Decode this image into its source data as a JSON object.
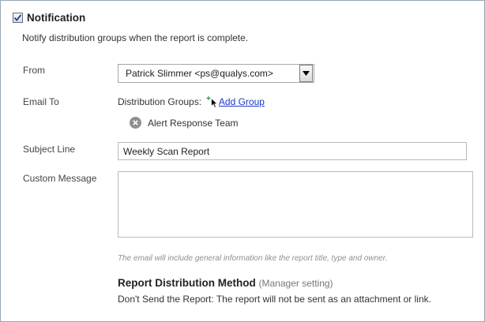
{
  "notification": {
    "checked": true,
    "title": "Notification",
    "description": "Notify distribution groups when the report is complete."
  },
  "from": {
    "label": "From",
    "selected": "Patrick Slimmer <ps@qualys.com>"
  },
  "email_to": {
    "label": "Email To",
    "distribution_label": "Distribution Groups:",
    "add_group_label": "Add Group",
    "groups": [
      "Alert Response Team"
    ]
  },
  "subject": {
    "label": "Subject Line",
    "value": "Weekly Scan Report"
  },
  "custom_message": {
    "label": "Custom Message",
    "value": "",
    "hint": "The email will include general information like the report title, type and owner."
  },
  "distribution_method": {
    "title": "Report Distribution Method",
    "subtitle": "(Manager setting)",
    "description": "Don't Send the Report: The report will not be sent as an attachment or link."
  },
  "colors": {
    "link": "#1a38c9",
    "border": "#9aa6b4",
    "hint": "#8f8f8f"
  }
}
